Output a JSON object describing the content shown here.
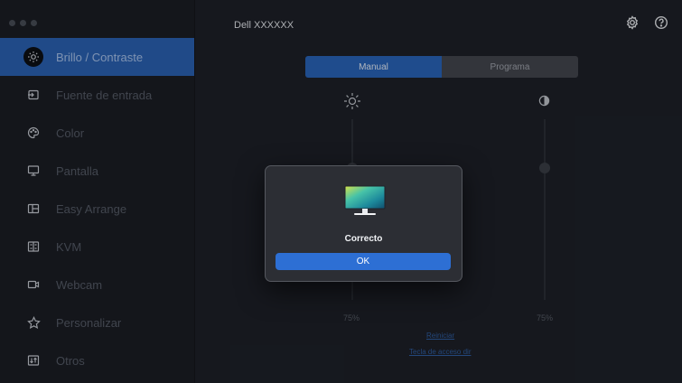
{
  "window": {
    "title": "Dell XXXXXX"
  },
  "sidebar": {
    "items": [
      {
        "label": "Brillo / Contraste",
        "icon": "brightness-icon",
        "active": true
      },
      {
        "label": "Fuente de entrada",
        "icon": "input-source-icon",
        "active": false
      },
      {
        "label": "Color",
        "icon": "palette-icon",
        "active": false
      },
      {
        "label": "Pantalla",
        "icon": "display-icon",
        "active": false
      },
      {
        "label": "Easy Arrange",
        "icon": "easy-arrange-icon",
        "active": false
      },
      {
        "label": "KVM",
        "icon": "kvm-icon",
        "active": false
      },
      {
        "label": "Webcam",
        "icon": "webcam-icon",
        "active": false
      },
      {
        "label": "Personalizar",
        "icon": "star-icon",
        "active": false
      },
      {
        "label": "Otros",
        "icon": "others-icon",
        "active": false
      }
    ]
  },
  "header": {
    "icons": [
      "gear-icon",
      "help-icon"
    ]
  },
  "main": {
    "tabs": [
      {
        "label": "Manual",
        "selected": true
      },
      {
        "label": "Programa",
        "selected": false
      }
    ],
    "brightness": {
      "icon": "sun-icon",
      "value_label": "75%",
      "value": 75
    },
    "contrast": {
      "icon": "contrast-icon",
      "value_label": "75%",
      "value": 75
    },
    "reset_link": "Reiniciar",
    "hotkey_link": "Tecla de acceso dir"
  },
  "dialog": {
    "icon": "monitor-icon",
    "title": "Correcto",
    "ok_label": "OK"
  },
  "colors": {
    "accent": "#2b63b6",
    "button": "#2d6fd4",
    "background": "#1e2129"
  }
}
